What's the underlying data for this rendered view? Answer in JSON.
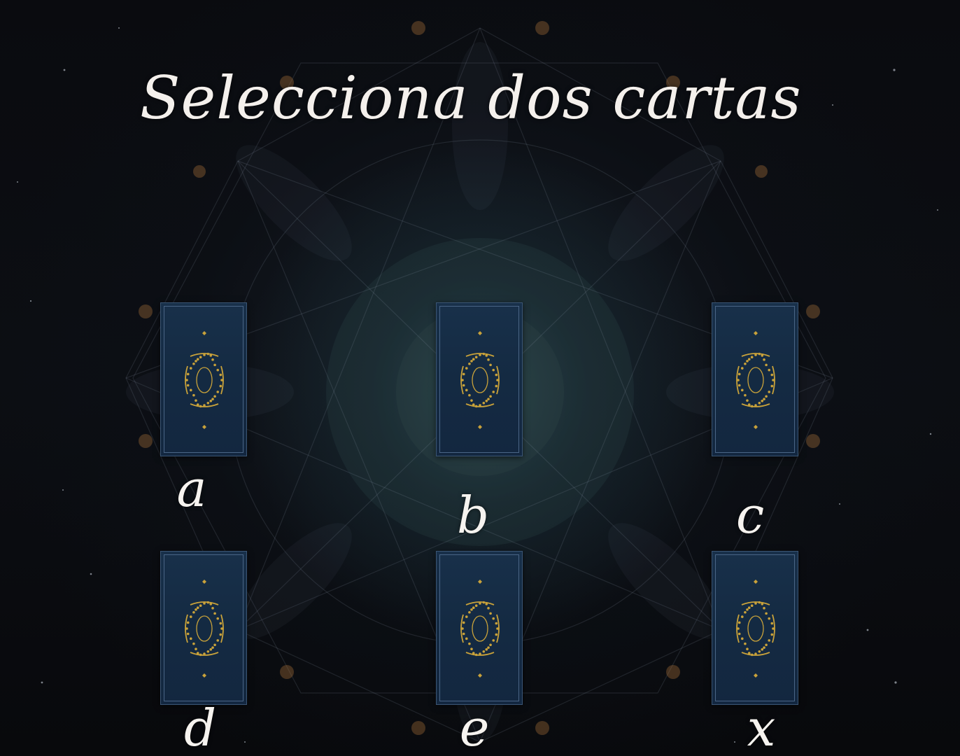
{
  "title": "Selecciona dos cartas",
  "colors": {
    "background": "#0a0b0f",
    "card_face": "#16304a",
    "card_ornament": "#c9a23a",
    "text": "#f4f0ec"
  },
  "card_icon": "ornate-card-back-icon",
  "cards": [
    {
      "label": "a"
    },
    {
      "label": "b"
    },
    {
      "label": "c"
    },
    {
      "label": "d"
    },
    {
      "label": "e"
    },
    {
      "label": "x"
    }
  ]
}
